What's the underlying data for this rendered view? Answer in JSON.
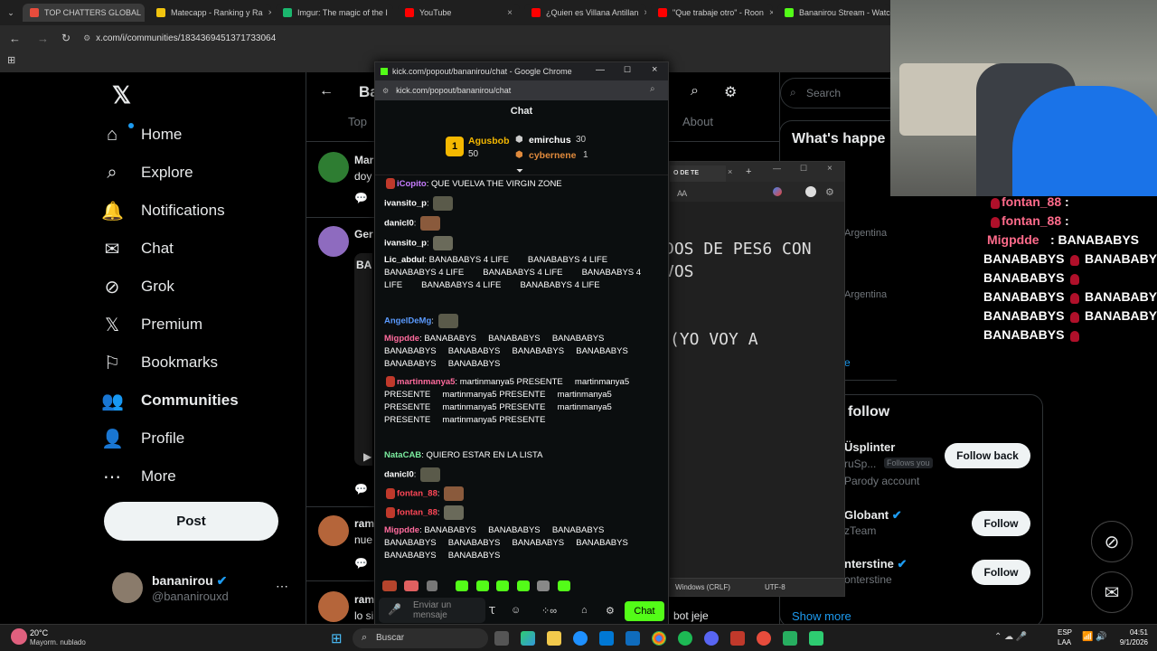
{
  "tabs": [
    {
      "title": "TOP CHATTERS GLOBAL",
      "color": "#e74c3c"
    },
    {
      "title": "Matecapp - Ranking y Ra",
      "color": "#f1c40f"
    },
    {
      "title": "Imgur: The magic of the I",
      "color": "#1bb76e"
    },
    {
      "title": "YouTube",
      "color": "#ff0000"
    },
    {
      "title": "¿Quien es Villana Antillan",
      "color": "#ff0000"
    },
    {
      "title": "\"Que trabaje otro\" - Roon",
      "color": "#ff0000"
    },
    {
      "title": "Bananirou Stream - Watc",
      "color": "#53fc18"
    }
  ],
  "address_bar": {
    "url": "x.com/i/communities/1834369451371733064"
  },
  "sidebar": {
    "items": [
      {
        "label": "Home",
        "icon": "home-icon",
        "glyph": "⌂"
      },
      {
        "label": "Explore",
        "icon": "search-icon",
        "glyph": "⌕"
      },
      {
        "label": "Notifications",
        "icon": "bell-icon",
        "glyph": "🔔"
      },
      {
        "label": "Chat",
        "icon": "mail-icon",
        "glyph": "✉"
      },
      {
        "label": "Grok",
        "icon": "grok-icon",
        "glyph": "⊘"
      },
      {
        "label": "Premium",
        "icon": "x-icon",
        "glyph": "𝕏"
      },
      {
        "label": "Bookmarks",
        "icon": "bookmark-icon",
        "glyph": "⚐"
      },
      {
        "label": "Communities",
        "icon": "communities-icon",
        "glyph": "👥"
      },
      {
        "label": "Profile",
        "icon": "profile-icon",
        "glyph": "👤"
      },
      {
        "label": "More",
        "icon": "more-icon",
        "glyph": "⋯"
      }
    ],
    "post_label": "Post",
    "account": {
      "name": "bananirou",
      "handle": "@bananirouxd"
    }
  },
  "feed": {
    "header_partial": "Ba",
    "tabs": {
      "top": "Top",
      "about": "About"
    },
    "posts": [
      {
        "name": "Mar",
        "text": "doy"
      },
      {
        "name": "Ger",
        "text": "BA"
      },
      {
        "name": "ram",
        "text": "nue"
      },
      {
        "name": "ram",
        "text": "lo si"
      }
    ],
    "bottom_text": "bot jeje"
  },
  "right": {
    "search_placeholder": "Search",
    "whats_happening": "What's happe",
    "trend_country_1": "Argentina",
    "trend_country_2": "Argentina",
    "who_to_follow": "follow",
    "follow_list": [
      {
        "name": "Üsplinter",
        "handle": "ruSp...",
        "badge": "Follows you",
        "sub": "Parody account",
        "button": "Follow back"
      },
      {
        "name": "Globant",
        "handle": "zTeam",
        "sub": "",
        "button": "Follow"
      },
      {
        "name": "nterstine",
        "handle": "onterstine",
        "sub": "",
        "button": "Follow"
      }
    ],
    "show_more": "Show more",
    "show_more_partial": "e"
  },
  "chat_popup": {
    "window_title": "kick.com/popout/bananirou/chat - Google Chrome",
    "url": "kick.com/popout/bananirou/chat",
    "header": "Chat",
    "leaderboard": {
      "first": {
        "rank": "1",
        "name": "Agusbob",
        "points": "50"
      },
      "second": {
        "name": "emirchus",
        "points": "30"
      },
      "third": {
        "name": "cybernene",
        "points": "1"
      }
    },
    "messages": [
      {
        "user": "iCopito",
        "color": "#c77dff",
        "text": "QUE VUELVA THE VIRGIN ZONE"
      },
      {
        "user": "ivansito_p",
        "color": "#ffffff",
        "text": ""
      },
      {
        "user": "danicl0",
        "color": "#ffffff",
        "text": ""
      },
      {
        "user": "ivansito_p",
        "color": "#ffffff",
        "text": ""
      },
      {
        "user": "Lic_abdul",
        "color": "#ffffff",
        "text": "BANABABYS 4 LIFE        BANABABYS 4 LIFE        BANABABYS 4 LIFE        BANABABYS 4 LIFE        BANABABYS 4 LIFE        BANABABYS 4 LIFE        BANABABYS 4 LIFE"
      },
      {
        "user": "AngelDeMg",
        "color": "#5b9bff",
        "text": ""
      },
      {
        "user": "Migpdde",
        "color": "#ff6b9d",
        "text": "BANABABYS     BANABABYS     BANABABYS     BANABABYS     BANABABYS     BANABABYS     BANABABYS     BANABABYS     BANABABYS"
      },
      {
        "user": "martinmanya5",
        "color": "#ff6b9d",
        "text": "martinmanya5 PRESENTE     martinmanya5 PRESENTE     martinmanya5 PRESENTE     martinmanya5 PRESENTE     martinmanya5 PRESENTE     martinmanya5 PRESENTE     martinmanya5 PRESENTE"
      },
      {
        "user": "NataCAB",
        "color": "#7bed9f",
        "text": "QUIERO ESTAR EN LA LISTA"
      },
      {
        "user": "danicl0",
        "color": "#ffffff",
        "text": ""
      },
      {
        "user": "fontan_88",
        "color": "#ff4757",
        "text": ""
      },
      {
        "user": "fontan_88",
        "color": "#ff4757",
        "text": ""
      },
      {
        "user": "Migpdde",
        "color": "#ff6b9d",
        "text": "BANABABYS     BANABABYS     BANABABYS     BANABABYS     BANABABYS     BANABABYS     BANABABYS     BANABABYS     BANABABYS"
      }
    ],
    "input_placeholder": "Enviar un mensaje",
    "send_label": "Chat"
  },
  "notepad": {
    "tab_partial": "O DE TE",
    "line1": "DOS DE PES6 CON",
    "line2": "VOS",
    "line3": "(YO VOY A",
    "status_eol": "Windows (CRLF)",
    "status_enc": "UTF-8"
  },
  "overlay_chat": {
    "lines": [
      {
        "user": "fontan_88",
        "text": ":"
      },
      {
        "user": "fontan_88",
        "text": ":"
      },
      {
        "user": "Migpdde",
        "text": ": BANABABYS"
      },
      {
        "text1": "BANABABYS",
        "text2": "BANABABYS"
      },
      {
        "text1": "BANABABYS",
        "text2": ""
      },
      {
        "text1": "BANABABYS",
        "text2": "BANABABYS"
      },
      {
        "text1": "BANABABYS",
        "text2": "BANABABYS"
      },
      {
        "text1": "BANABABYS",
        "text2": ""
      }
    ]
  },
  "taskbar": {
    "weather_temp": "20°C",
    "weather_desc": "Mayorm. nublado",
    "search_placeholder": "Buscar",
    "lang": "ESP",
    "lang2": "LAA",
    "time": "04:51",
    "date": "9/1/2026"
  }
}
